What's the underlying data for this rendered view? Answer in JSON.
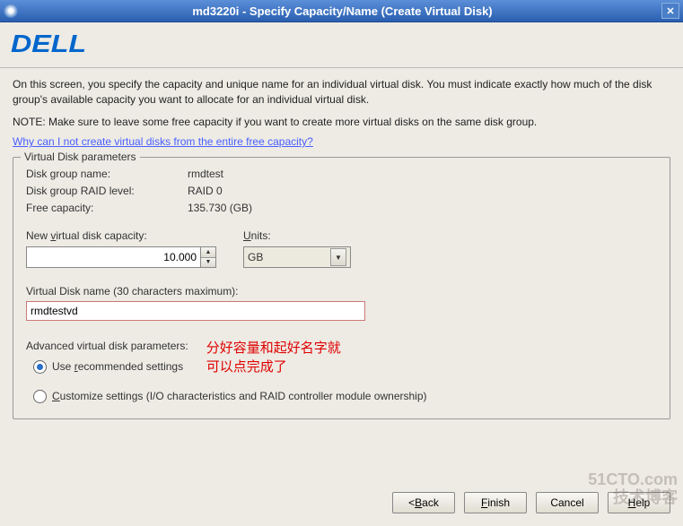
{
  "titlebar": {
    "title": "md3220i - Specify Capacity/Name (Create Virtual Disk)"
  },
  "logo": {
    "text": "DELL"
  },
  "description": "On this screen, you specify the capacity and unique name for an individual virtual disk. You must indicate exactly how much of the disk group's available capacity you want to allocate for an individual virtual disk.",
  "note": "NOTE: Make sure to leave some free capacity if you want to create more virtual disks on the same disk group.",
  "help_link": "Why can I not create virtual disks from the entire free capacity?",
  "fieldset": {
    "legend": "Virtual Disk parameters",
    "disk_group_name_label": "Disk group name:",
    "disk_group_name_value": "rmdtest",
    "raid_label": "Disk group RAID level:",
    "raid_value": "RAID 0",
    "free_label": "Free capacity:",
    "free_value": "135.730 (GB)",
    "capacity_label": "New virtual disk capacity:",
    "capacity_value": "10.000",
    "units_label": "Units:",
    "units_value": "GB",
    "vd_name_label": "Virtual Disk name (30 characters maximum):",
    "vd_name_value": "rmdtestvd",
    "adv_label": "Advanced virtual disk parameters:",
    "radio_recommended_prefix": "Use ",
    "radio_recommended_u": "r",
    "radio_recommended_suffix": "ecommended settings",
    "radio_customize_u": "C",
    "radio_customize_suffix": "ustomize settings (I/O characteristics and RAID controller module ownership)"
  },
  "annotation": {
    "line1": "分好容量和起好名字就",
    "line2": "可以点完成了"
  },
  "buttons": {
    "back": "< Back",
    "finish": "Finish",
    "cancel": "Cancel",
    "help": "Help"
  },
  "watermark": {
    "line1": "51CTO.com",
    "line2": "技术博客"
  }
}
